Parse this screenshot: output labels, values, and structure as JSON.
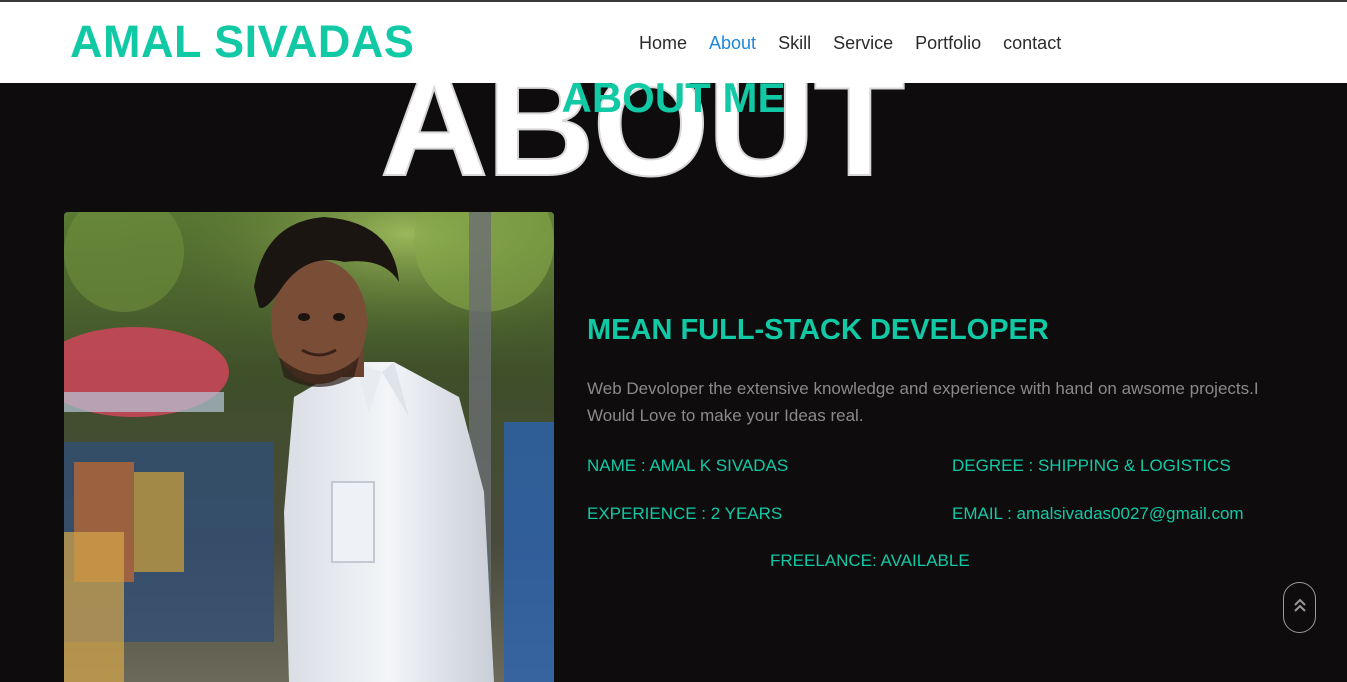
{
  "header": {
    "brand": "AMAL SIVADAS",
    "nav": [
      {
        "label": "Home",
        "active": false
      },
      {
        "label": "About",
        "active": true
      },
      {
        "label": "Skill",
        "active": false
      },
      {
        "label": "Service",
        "active": false
      },
      {
        "label": "Portfolio",
        "active": false
      },
      {
        "label": "contact",
        "active": false
      }
    ]
  },
  "section": {
    "background_word": "ABOUT",
    "title": "ABOUT ME"
  },
  "profile": {
    "photo_icon": "portrait-photo",
    "headline": "MEAN FULL-STACK DEVELOPER",
    "description": "Web Devoloper the extensive knowledge and experience with hand on awsome projects.I Would Love to make your Ideas real.",
    "name": "NAME : AMAL K SIVADAS",
    "degree": "DEGREE : SHIPPING & LOGISTICS",
    "experience": "EXPERIENCE : 2 YEARS",
    "email": "EMAIL : amalsivadas0027@gmail.com",
    "freelance": "FREELANCE: AVAILABLE"
  },
  "controls": {
    "scroll_top_icon": "double-chevron-up-icon"
  },
  "colors": {
    "accent": "#12c9a6",
    "active_link": "#1f87d8",
    "background": "#0e0c0d",
    "text_muted": "#8a8a8a"
  }
}
